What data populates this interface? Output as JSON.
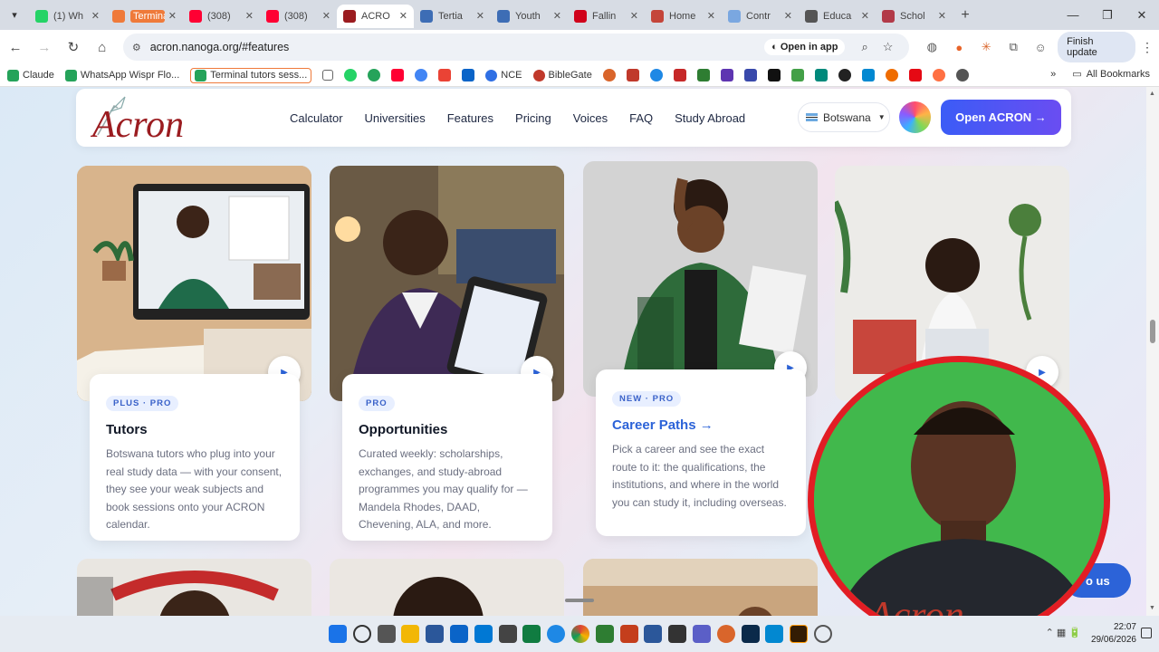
{
  "tabs": [
    {
      "title": "(1) Wh",
      "color": "#25d366"
    },
    {
      "title": "Terminal tutors ses",
      "color": "#ef7a3a",
      "highlight": true
    },
    {
      "title": "(308)",
      "color": "#ff0033"
    },
    {
      "title": "(308)",
      "color": "#ff0033"
    },
    {
      "title": "ACRO",
      "color": "#9b1c20",
      "active": true
    },
    {
      "title": "Tertia",
      "color": "#3d6db5"
    },
    {
      "title": "Youth",
      "color": "#3d6db5"
    },
    {
      "title": "Fallin",
      "color": "#d0021b"
    },
    {
      "title": "Home",
      "color": "#c4453a"
    },
    {
      "title": "Contr",
      "color": "#7aa7e0"
    },
    {
      "title": "Educa",
      "color": "#555"
    },
    {
      "title": "Schol",
      "color": "#b23a48"
    }
  ],
  "address": {
    "url": "acron.nanoga.org/#features",
    "open_in_app": "Open in app",
    "finish_update": "Finish update"
  },
  "bookmarks": {
    "items": [
      {
        "label": "Claude",
        "color": "#25a35a"
      },
      {
        "label": "WhatsApp Wispr Flo...",
        "color": "#25a35a"
      },
      {
        "label": "Terminal tutors sess...",
        "color": "#25a35a",
        "highlight": true
      }
    ],
    "extras": [
      {
        "label": "NCE",
        "color": "#2f6fe4"
      },
      {
        "label": "BibleGate",
        "color": "#c0392b"
      }
    ],
    "all_bookmarks": "All Bookmarks"
  },
  "site": {
    "brand": "Acron",
    "nav": [
      "Calculator",
      "Universities",
      "Features",
      "Pricing",
      "Voices",
      "FAQ",
      "Study Abroad"
    ],
    "country": "Botswana",
    "cta": "Open ACRON →",
    "contact": "o us"
  },
  "features": [
    {
      "badge": "PLUS · PRO",
      "title": "Tutors",
      "desc": "Botswana tutors who plug into your real study data — with your consent, they see your weak subjects and book sessions onto your ACRON calendar."
    },
    {
      "badge": "PRO",
      "title": "Opportunities",
      "desc": "Curated weekly: scholarships, exchanges, and study-abroad programmes you may qualify for — Mandela Rhodes, DAAD, Chevening, ALA, and more."
    },
    {
      "badge": "NEW · PRO",
      "title": "Career Paths →",
      "desc": "Pick a career and see the exact route to it: the qualifications, the institutions, and where in the world you can study it, including overseas."
    }
  ],
  "clock": {
    "time": "22:07",
    "date": "29/06/2026"
  },
  "colors": {
    "accent": "#2c63d8",
    "brand_red": "#9b1c20",
    "cta_start": "#3b5cf6",
    "cta_end": "#6a4df2"
  }
}
